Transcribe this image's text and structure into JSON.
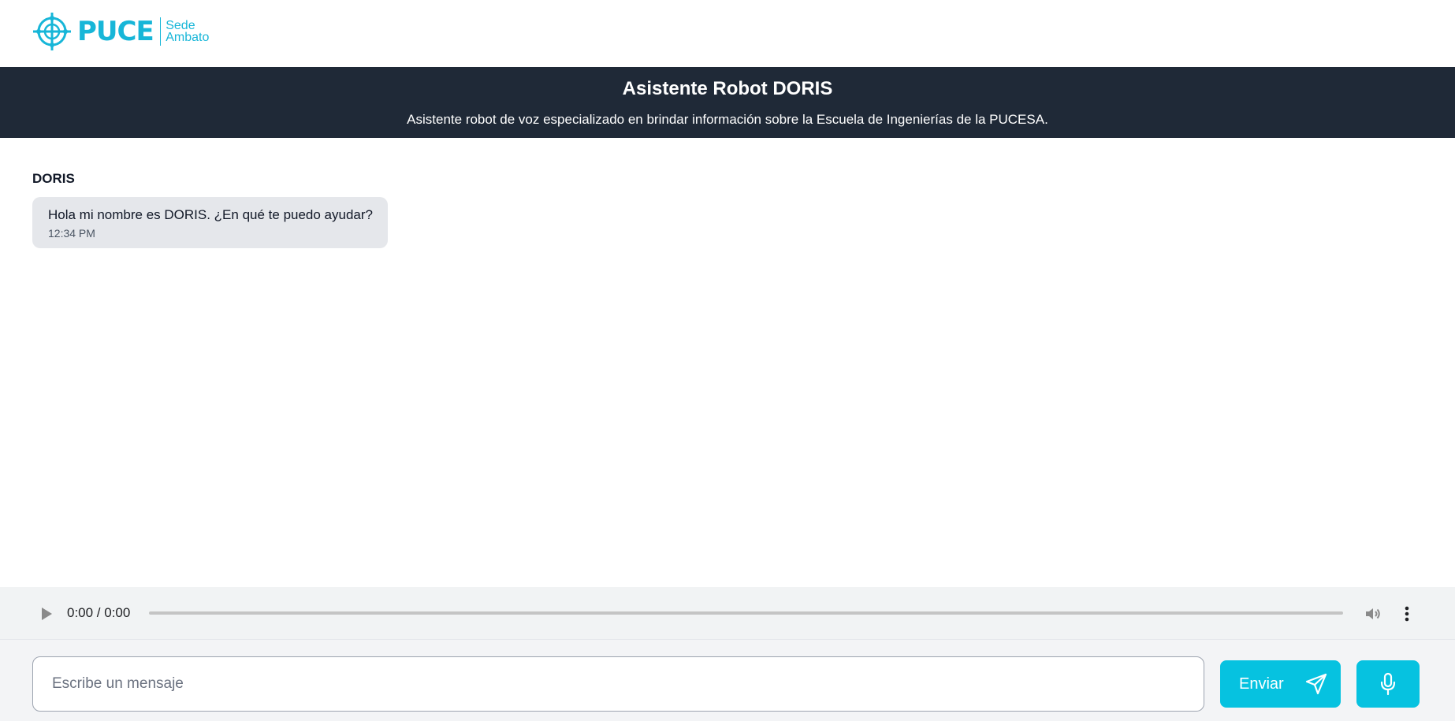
{
  "header": {
    "logo": {
      "brand": "PUCE",
      "sub_line1": "Sede",
      "sub_line2": "Ambato"
    }
  },
  "banner": {
    "title": "Asistente Robot DORIS",
    "subtitle": "Asistente robot de voz especializado en brindar información sobre la Escuela de Ingenierías de la PUCESA."
  },
  "chat": {
    "messages": [
      {
        "sender": "DORIS",
        "text": "Hola mi nombre es DORIS. ¿En qué te puedo ayudar?",
        "time": "12:34 PM"
      }
    ]
  },
  "audio_player": {
    "time": "0:00 / 0:00",
    "progress": 0,
    "icons": {
      "play": "play-icon",
      "volume": "volume-icon",
      "menu": "more-options-icon"
    }
  },
  "composer": {
    "placeholder": "Escribe un mensaje",
    "value": "",
    "send_label": "Enviar",
    "icons": {
      "send": "send-icon",
      "mic": "microphone-icon"
    }
  },
  "colors": {
    "brand": "#17b6d8",
    "accent_button": "#06c2e0",
    "banner_bg": "#1f2937",
    "bubble_bg": "#e5e7eb"
  }
}
